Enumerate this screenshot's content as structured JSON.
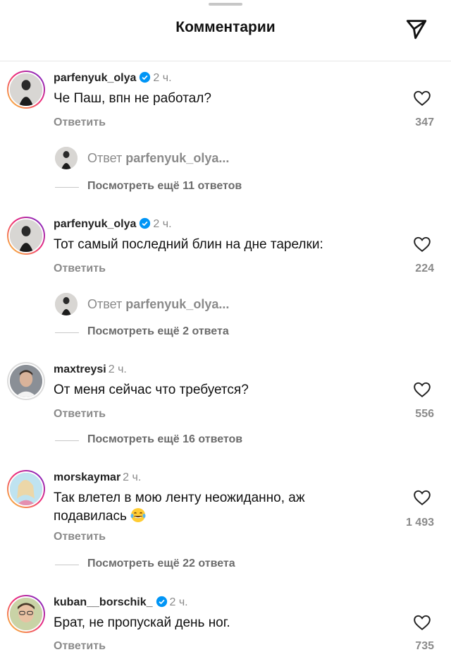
{
  "header": {
    "title": "Комментарии"
  },
  "comments": [
    {
      "username": "parfenyuk_olya",
      "verified": true,
      "time": "2 ч.",
      "text": "Че Паш, впн не работал?",
      "reply_label": "Ответить",
      "likes": "347",
      "thread": {
        "prefix": "Ответ",
        "user": "parfenyuk_olya..."
      },
      "more": "Посмотреть ещё 11 ответов"
    },
    {
      "username": "parfenyuk_olya",
      "verified": true,
      "time": "2 ч.",
      "text": "Тот самый последний блин на дне тарелки:",
      "reply_label": "Ответить",
      "likes": "224",
      "thread": {
        "prefix": "Ответ",
        "user": "parfenyuk_olya..."
      },
      "more": "Посмотреть ещё 2 ответа"
    },
    {
      "username": "maxtreysi",
      "verified": false,
      "time": "2 ч.",
      "text": "От меня сейчас что требуется?",
      "reply_label": "Ответить",
      "likes": "556",
      "more": "Посмотреть ещё 16 ответов"
    },
    {
      "username": "morskaymar",
      "verified": false,
      "time": "2 ч.",
      "text": "Так влетел в мою ленту неожиданно, аж подавилась",
      "reply_label": "Ответить",
      "likes": "1 493",
      "more": "Посмотреть ещё 22 ответа"
    },
    {
      "username": "kuban__borschik_",
      "verified": true,
      "time": "2 ч.",
      "text": "Брат, не пропускай день ног.",
      "reply_label": "Ответить",
      "likes": "735"
    }
  ],
  "icons": {
    "share": "paper-plane-icon",
    "like": "heart-icon",
    "verified": "verified-badge-icon",
    "emoji": "tears-of-joy-emoji-icon"
  },
  "colors": {
    "accent_verified": "#0095f6",
    "muted_text": "#8a8a8a"
  }
}
